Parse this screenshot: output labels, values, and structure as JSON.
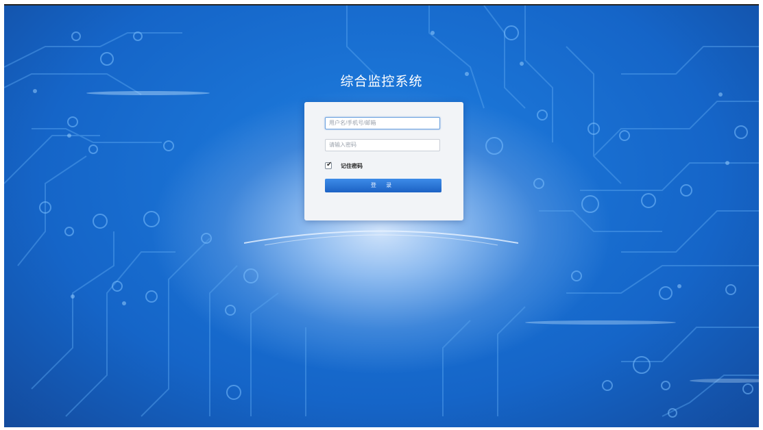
{
  "app": {
    "title": "综合监控系统"
  },
  "login_form": {
    "username_placeholder": "用户名/手机号/邮箱",
    "password_placeholder": "请输入密码",
    "remember_label": "记住密码",
    "remember_checked": true,
    "login_button_label": "登 录"
  },
  "colors": {
    "background_primary": "#1565c8",
    "button_primary": "#2a76d8",
    "panel_background": "#f2f4f7"
  }
}
